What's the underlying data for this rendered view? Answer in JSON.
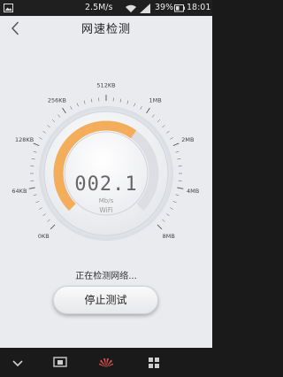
{
  "status_bar": {
    "network_speed": "2.5M/s",
    "battery_percent": "39%",
    "time": "18:01",
    "icons": [
      "image-notification-icon",
      "wifi-icon",
      "signal-icon",
      "battery-icon"
    ]
  },
  "header": {
    "title": "网速检测",
    "back_icon": "chevron-left-icon"
  },
  "gauge": {
    "scale_labels": [
      "0KB",
      "64KB",
      "128KB",
      "256KB",
      "512KB",
      "1MB",
      "2MB",
      "4MB",
      "8MB"
    ],
    "reading": "002.1",
    "unit": "Mb/s",
    "connection_label": "WiFi",
    "progress_fraction": 0.63,
    "colors": {
      "progress": "#f4ad5a",
      "track": "#dcdee3",
      "dial_face": "#f5f6f8",
      "ticks": "#555555"
    }
  },
  "status_text": "正在检测网络...",
  "stop_button": {
    "label": "停止测试"
  },
  "nav_bar": {
    "icons": [
      "chevron-down-icon",
      "screen-cast-icon",
      "huawei-logo",
      "menu-grid-icon"
    ]
  }
}
